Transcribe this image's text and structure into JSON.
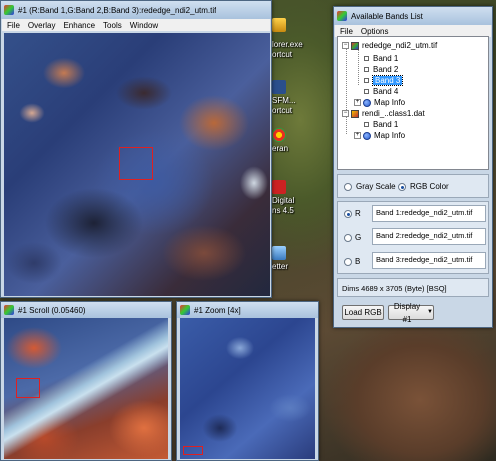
{
  "desktop": {
    "icons": [
      {
        "label": "lorer.exe"
      },
      {
        "label": "ortcut"
      },
      {
        "label": "SFM..."
      },
      {
        "label": "ortcut"
      },
      {
        "label": "eran"
      },
      {
        "label": "Digital"
      },
      {
        "label": "ns 4.5"
      },
      {
        "label": "etter"
      }
    ]
  },
  "main_window": {
    "title": "#1 (R:Band 1,G:Band 2,B:Band 3):rededge_ndi2_utm.tif",
    "menu": [
      "File",
      "Overlay",
      "Enhance",
      "Tools",
      "Window"
    ]
  },
  "scroll_window": {
    "title": "#1 Scroll (0.05460)"
  },
  "zoom_window": {
    "title": "#1 Zoom [4x]"
  },
  "bands_window": {
    "title": "Available Bands List",
    "menu": [
      "File",
      "Options"
    ],
    "tree": {
      "file1": "rededge_ndi2_utm.tif",
      "file1_bands": [
        "Band 1",
        "Band 2",
        "Band 3",
        "Band 4"
      ],
      "file1_map": "Map Info",
      "file2": "rendi_..class1.dat",
      "file2_bands": [
        "Band 1"
      ],
      "file2_map": "Map Info",
      "selected": "Band 3"
    },
    "mode": {
      "grayscale_label": "Gray Scale",
      "rgb_label": "RGB Color",
      "selected": "RGB Color"
    },
    "rgb": {
      "r_label": "R",
      "g_label": "G",
      "b_label": "B",
      "r_value": "Band 1:rededge_ndi2_utm.tif",
      "g_value": "Band 2:rededge_ndi2_utm.tif",
      "b_value": "Band 3:rededge_ndi2_utm.tif"
    },
    "dims": "Dims 4689 x 3705 (Byte) [BSQ]",
    "load_button": "Load RGB",
    "display_button": "Display #1"
  },
  "colors": {
    "title_gradient_top": "#cfdff0",
    "title_gradient_bottom": "#a9c2dd",
    "selection": "#3399ff",
    "roi_box": "#e02020",
    "close_button": "#c04630"
  },
  "icons": [
    "window-icon",
    "minimize-icon",
    "maximize-icon",
    "close-icon",
    "tree-collapse-icon",
    "tree-expand-icon",
    "globe-icon",
    "dropdown-arrow-icon"
  ]
}
